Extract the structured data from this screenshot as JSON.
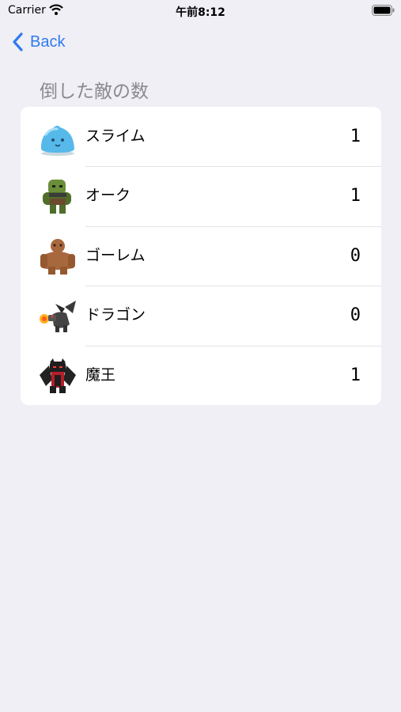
{
  "status_bar": {
    "carrier": "Carrier",
    "time": "午前8:12"
  },
  "nav": {
    "back_label": "Back"
  },
  "section": {
    "title": "倒した敵の数"
  },
  "enemies": [
    {
      "name": "スライム",
      "count": "1",
      "icon": "slime-icon"
    },
    {
      "name": "オーク",
      "count": "1",
      "icon": "orc-icon"
    },
    {
      "name": "ゴーレム",
      "count": "0",
      "icon": "golem-icon"
    },
    {
      "name": "ドラゴン",
      "count": "0",
      "icon": "dragon-icon"
    },
    {
      "name": "魔王",
      "count": "1",
      "icon": "demon-king-icon"
    }
  ],
  "colors": {
    "accent": "#2f7bf0",
    "background": "#f0eff5",
    "card": "#ffffff"
  }
}
